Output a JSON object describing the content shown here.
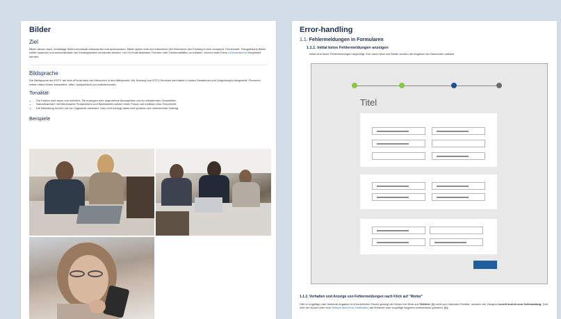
{
  "left_page": {
    "title": "Bilder",
    "ziel": {
      "heading": "Ziel",
      "text_before_link": "Bilder dienen dazu, textlastige Seiten emotional aufzuwerten und aufzulockern. Bilder geben Halt und erleichtern den Benutzern den Einstieg in eine komplexe Thenenwelt. Fotografische Bilder sollten spannen und ausschliesslich bei Einstiegsseiten verwendet werden. Um Ihr Inhalt abstrakte Themen oder Funktionalitäten zu erklären, können statt Fotos ",
      "link_text": "UI-Illustrationen",
      "text_after_link": " eingesetzt werden."
    },
    "bildsprache": {
      "heading": "Bildsprache",
      "text": "Die Bildsprache der ESTV auf dem ePortal setzt der Menschen in den Mittelpunkt. Die Nutzung von ESTV-Services wird dabei in realen Situationen und Umgebungen dargestellt. Personen wirken dabei immer kompetent, offen, sympathisch und selbstbewusst."
    },
    "tonalitaet": {
      "heading": "Tonalität",
      "bullets": [
        "Die Farben sind warm und natürlich. Sie erzeugen eine angenehme Atmosphäre und ein einladendes Gesamtbild.",
        "Nahaufnahmen mit interessante Perspektiven und Blickwinkeln setzen einen Fokus und erzählen eine Geschichte.",
        "Die Belichtung ist hell und von Tageslicht dominiert. Das Licht erzeugt dabei eine positive und motivierende Haltung."
      ]
    },
    "beispiele": {
      "heading": "Beispiele"
    }
  },
  "right_page": {
    "title": "Error-handling",
    "section": {
      "number": "1.1.",
      "title": "Fehlermeldungen in Formularen"
    },
    "subsection_1": {
      "number": "1.1.1.",
      "title": "Initial keine Fehlermeldungen anzeigen",
      "text": "Initial sind keine Fehlermeldungen angezeigt. Erst durch Klick auf Weiter werden die Angaben der Nutzenden validiert."
    },
    "mockup": {
      "form_title": "Titel",
      "step_colors": [
        "#8cc63f",
        "#8cc63f",
        "#1f4e8c",
        "#6d6d6d"
      ],
      "button_color": "#1f5d9c"
    },
    "subsection_2": {
      "number": "1.1.2.",
      "title": "Verhalten und Anzeige von Fehlermeldungen nach Klick auf \"Weiter\"",
      "text_part1": "Gibt er ungültige oder fehlende Angaben in erforderlichen Felder gelangt der Nutzer bei Klick auf ",
      "text_bold1": "«Weiter» (1)",
      "text_part2": " nicht zum nächsten Schritte, sondern der Viewport ",
      "text_bold2": "scrollt zurück zum Seitenanfang",
      "text_part3": ". Dort wird der Nutzer über eine ",
      "link_text": "Oblique Alert error-Notification",
      "text_part4": " auf fehlende oder ungültige Angaben aufmerksam gemacht. ",
      "text_bold3": "(2)."
    }
  }
}
